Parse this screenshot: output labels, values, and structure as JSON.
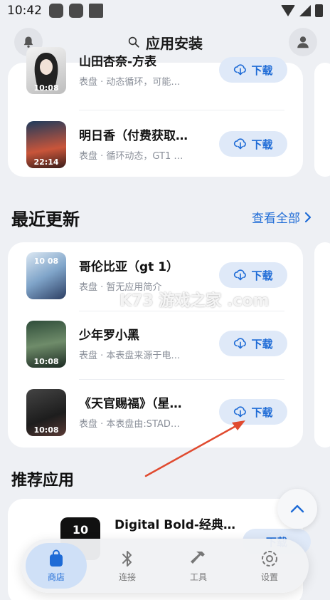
{
  "status": {
    "time": "10:42"
  },
  "header": {
    "title": "应用安装"
  },
  "top_list": [
    {
      "name": "山田杏奈-方表",
      "desc": "表盘 · 动态循环，可能…",
      "download": "下载",
      "time": "10:08"
    },
    {
      "name": "明日香（付费获取…",
      "desc": "表盘 · 循环动态，GT1 …",
      "download": "下载",
      "time": "22:14"
    }
  ],
  "recent": {
    "title": "最近更新",
    "see_all": "查看全部",
    "items": [
      {
        "name": "哥伦比亚（gt 1）",
        "desc": "表盘 · 暂无应用简介",
        "download": "下载",
        "time": "10 08"
      },
      {
        "name": "少年罗小黑",
        "desc": "表盘 · 本表盘来源于电…",
        "download": "下载",
        "time": "10:08"
      },
      {
        "name": "《天官赐福》（星…",
        "desc": "表盘 · 本表盘由:STAD…",
        "download": "下载",
        "time": "10:08"
      }
    ]
  },
  "recommended": {
    "title": "推荐应用",
    "items": [
      {
        "name": "Digital Bold-经典…",
        "download": "下载",
        "time": "10"
      }
    ]
  },
  "watermark": "K73 游戏之家 .com",
  "nav": [
    {
      "label": "商店",
      "icon": "shopping-bag-icon"
    },
    {
      "label": "连接",
      "icon": "bluetooth-icon"
    },
    {
      "label": "工具",
      "icon": "hammer-icon"
    },
    {
      "label": "设置",
      "icon": "settings-icon"
    }
  ],
  "colors": {
    "accent": "#1e6bd6",
    "button_bg": "#dfe9f8",
    "annotation": "#e04a2f"
  }
}
